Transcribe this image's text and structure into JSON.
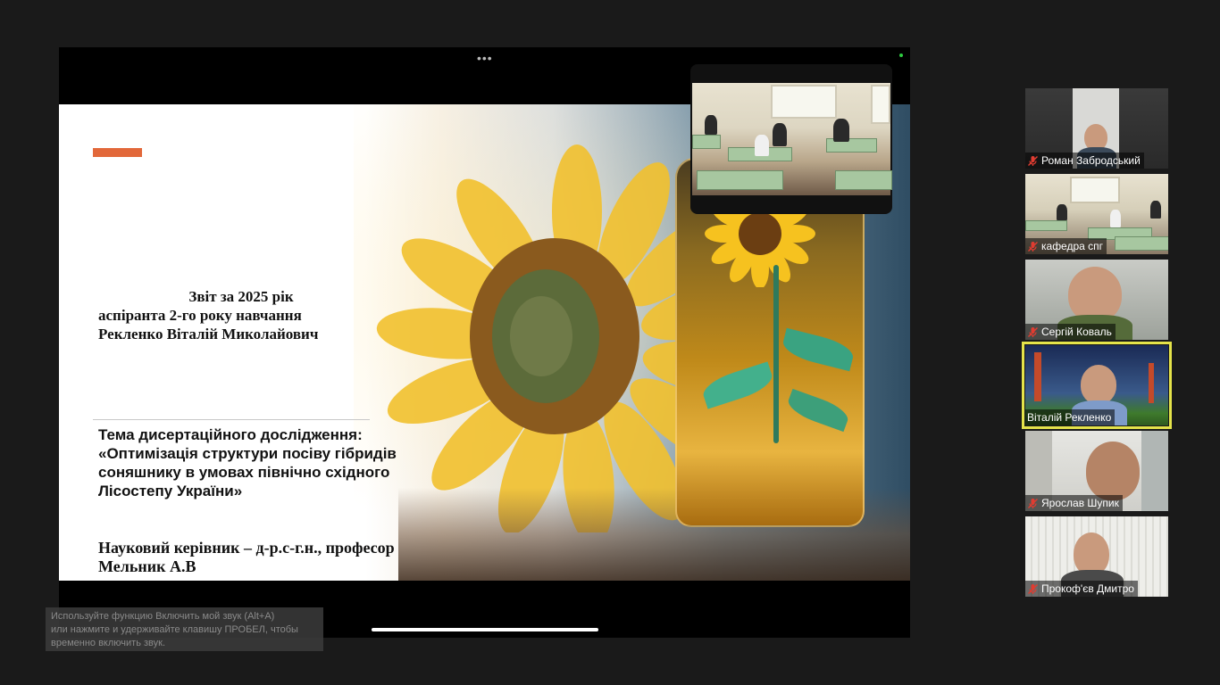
{
  "slide": {
    "title_line1": "Звіт за 2025 рік",
    "title_line2": "аспіранта 2-го року навчання",
    "title_line3": "Рекленко Віталій Миколайович",
    "topic_heading": "Тема дисертаційного дослідження:",
    "topic_line1": "«Оптимізація структури посіву гібридів",
    "topic_line2": "соняшнику в умовах північно східного",
    "topic_line3": "Лісостепу України»",
    "supervisor_line1": "Науковий керівник – д-р.с-г.н., професор",
    "supervisor_line2": "Мельник А.В"
  },
  "share": {
    "menu_label": "•••"
  },
  "hint": {
    "line1": "Используйте функцию Включить мой звук (Alt+A)",
    "line2": "или нажмите и удерживайте клавишу ПРОБЕЛ, чтобы",
    "line3": "временно включить звук."
  },
  "participants": [
    {
      "name": "Роман Забродський",
      "muted": true,
      "active": false
    },
    {
      "name": "кафедра спг",
      "muted": true,
      "active": false
    },
    {
      "name": "Сергій Коваль",
      "muted": true,
      "active": false
    },
    {
      "name": "Віталій Рекленко",
      "muted": false,
      "active": true
    },
    {
      "name": "Ярослав Шупик",
      "muted": true,
      "active": false
    },
    {
      "name": "Прокоф'єв Дмитро",
      "muted": true,
      "active": false
    }
  ],
  "colors": {
    "accent_bar": "#e2683a",
    "active_speaker_border": "#e4e34a",
    "mic_muted": "#e03c31"
  }
}
